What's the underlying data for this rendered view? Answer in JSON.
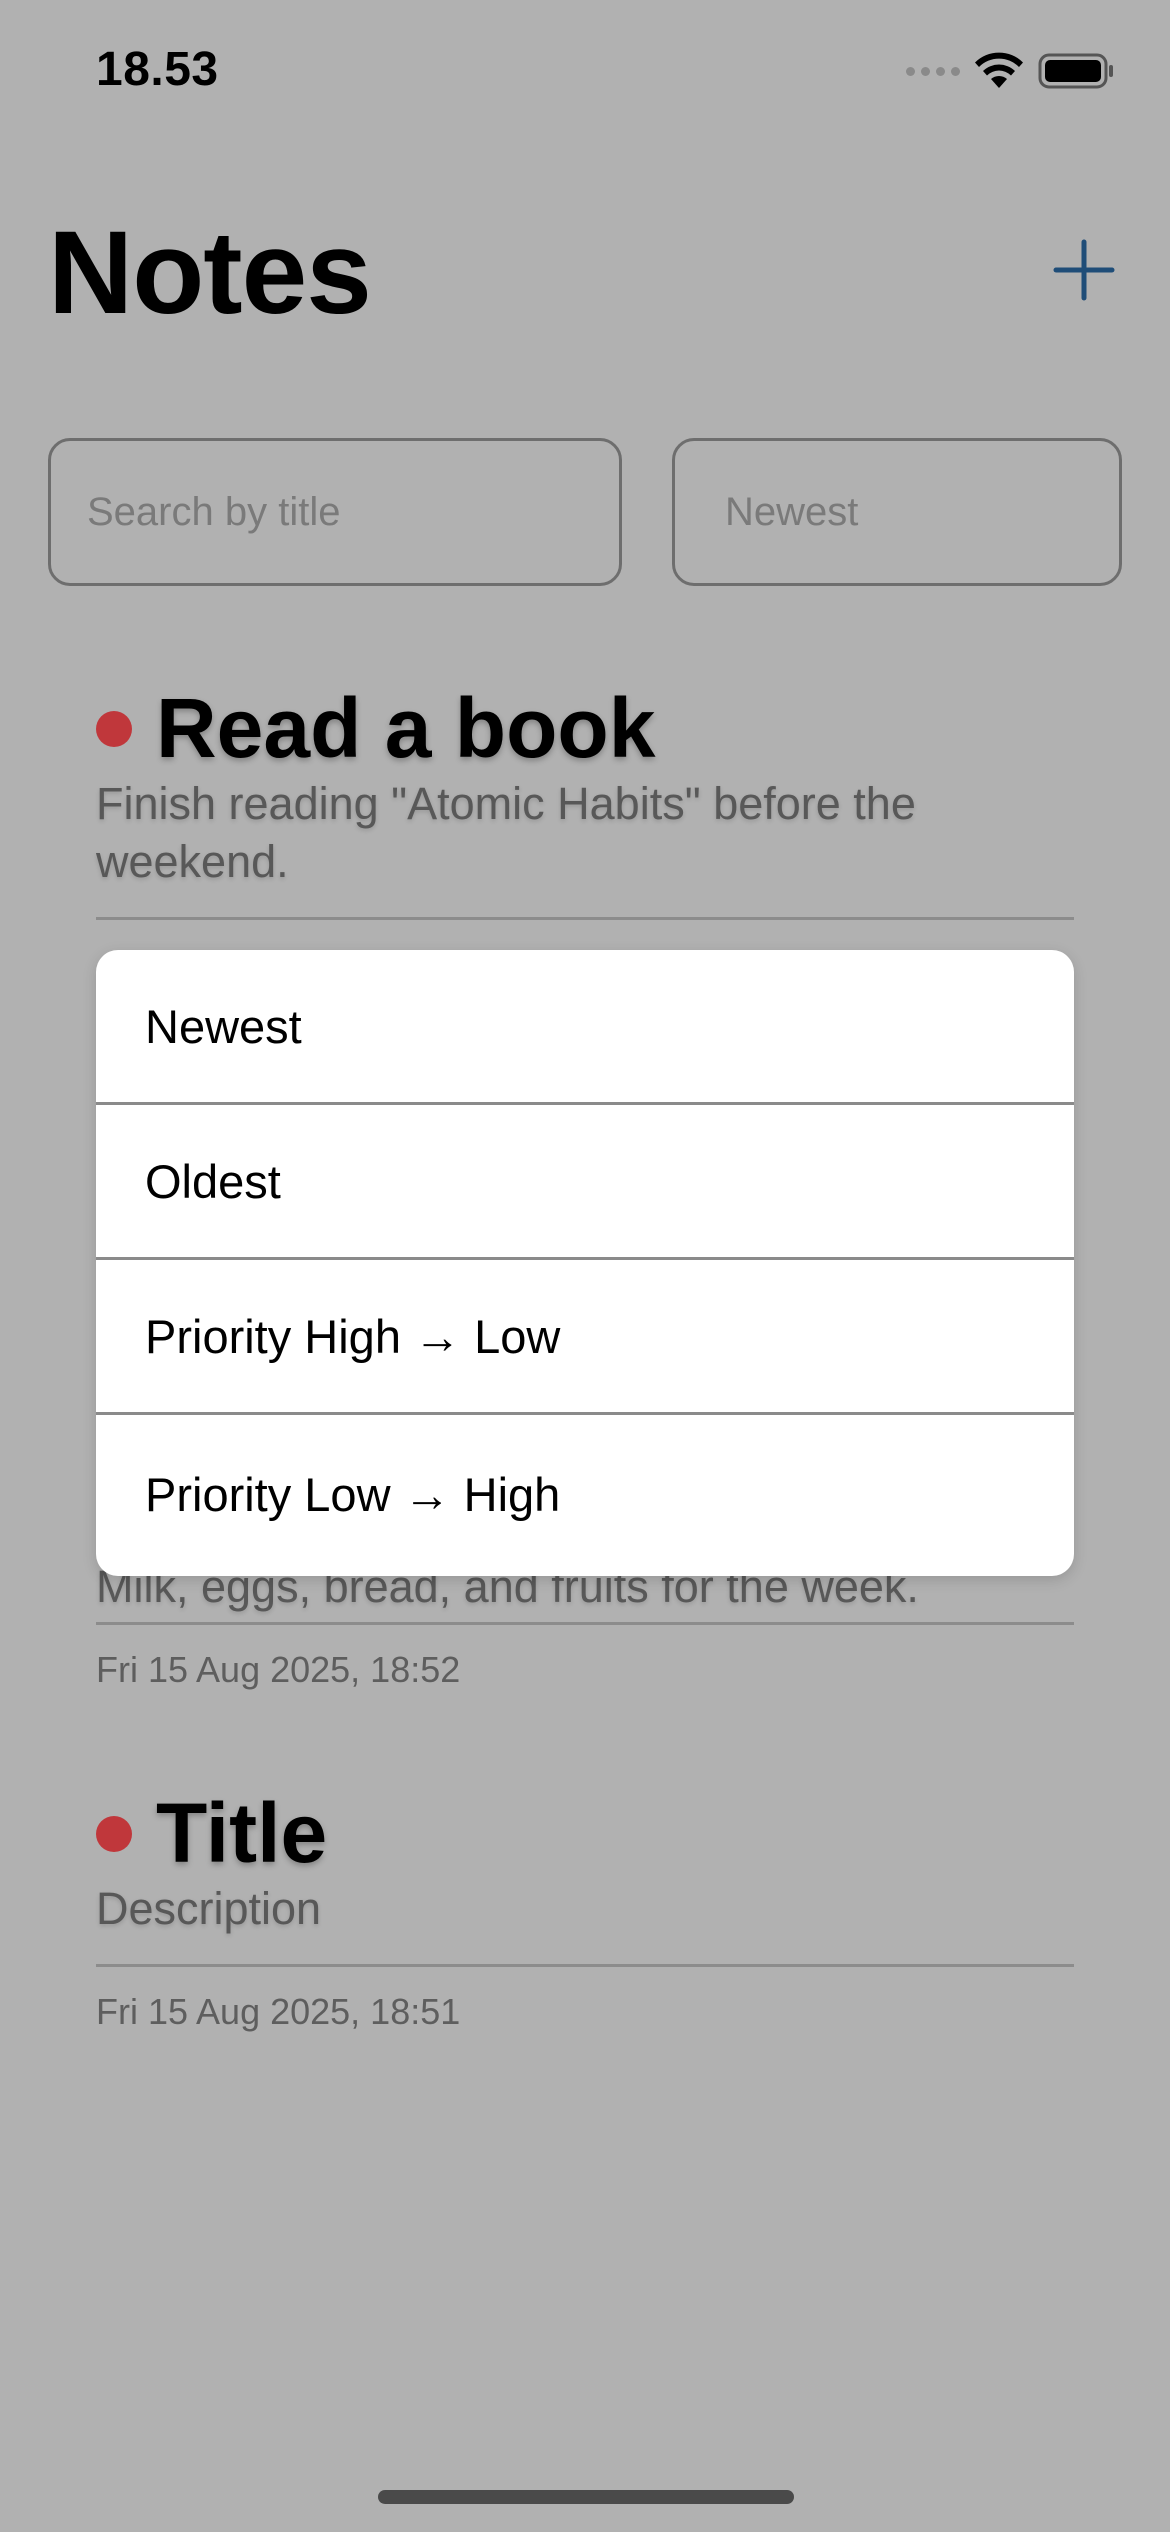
{
  "status_bar": {
    "time": "18.53"
  },
  "header": {
    "title": "Notes",
    "add_icon": "plus-icon"
  },
  "controls": {
    "search_placeholder": "Search by title",
    "sort_value": "Newest"
  },
  "notes": [
    {
      "title": "Read a book",
      "description": "Finish reading \"Atomic Habits\" before the weekend.",
      "priority_color": "#c0373b"
    },
    {
      "description": "Milk, eggs, bread, and fruits for the week.",
      "date": "Fri 15 Aug 2025, 18:52"
    },
    {
      "title": "Title",
      "description": "Description",
      "date": "Fri 15 Aug 2025, 18:51",
      "priority_color": "#c0373b"
    }
  ],
  "sort_menu": {
    "options": [
      "Newest",
      "Oldest",
      "Priority High → Low",
      "Priority Low → High"
    ]
  },
  "colors": {
    "accent": "#1f4d78",
    "overlay_background": "#b1b1b1",
    "priority_high": "#c0373b"
  }
}
